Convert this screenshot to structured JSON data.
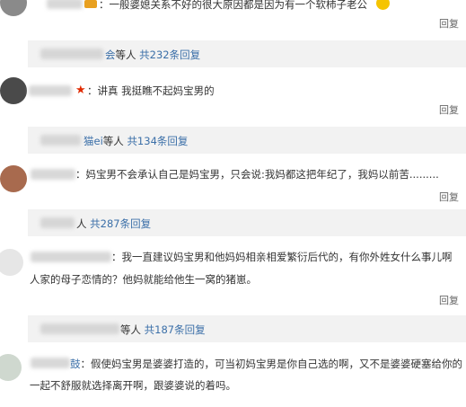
{
  "comments": [
    {
      "text": "一般婆媳关系不好的很大原因都是因为有一个软柿子老公",
      "reply": "回复",
      "sub": {
        "name_suffix": "会",
        "mid": "等人",
        "count_text": "共232条回复"
      }
    },
    {
      "text": "讲真 我挺瞧不起妈宝男的",
      "reply": "回复",
      "sub": {
        "name_suffix": "猫ei",
        "mid": "等人",
        "count_text": "共134条回复"
      }
    },
    {
      "text": "妈宝男不会承认自己是妈宝男，只会说:我妈都这把年纪了，我妈以前苦.........",
      "reply": "回复",
      "sub": {
        "name_suffix": "",
        "mid": "人",
        "count_text": "共287条回复"
      }
    },
    {
      "text_line1": "我一直建议妈宝男和他妈妈相亲相爱繁衍后代的，有你外姓女什么事儿啊",
      "text_line2": "人家的母子恋情的？他妈就能给他生一窝的猪崽。",
      "reply": "回复",
      "sub": {
        "name_suffix": "",
        "mid": "等人",
        "count_text": "共187条回复"
      }
    },
    {
      "name_suffix": "鼓",
      "text_line1": "假使妈宝男是婆婆打造的，可当初妈宝男是你自己选的啊，又不是婆婆硬塞给你的",
      "text_line2": "一起不舒服就选择离开啊，跟婆婆说的着吗。"
    }
  ],
  "colors": {
    "link": "#3b6fa8",
    "sub_bg": "#f2f2f2",
    "star": "#e02a00",
    "emoji": "#f5c400"
  }
}
